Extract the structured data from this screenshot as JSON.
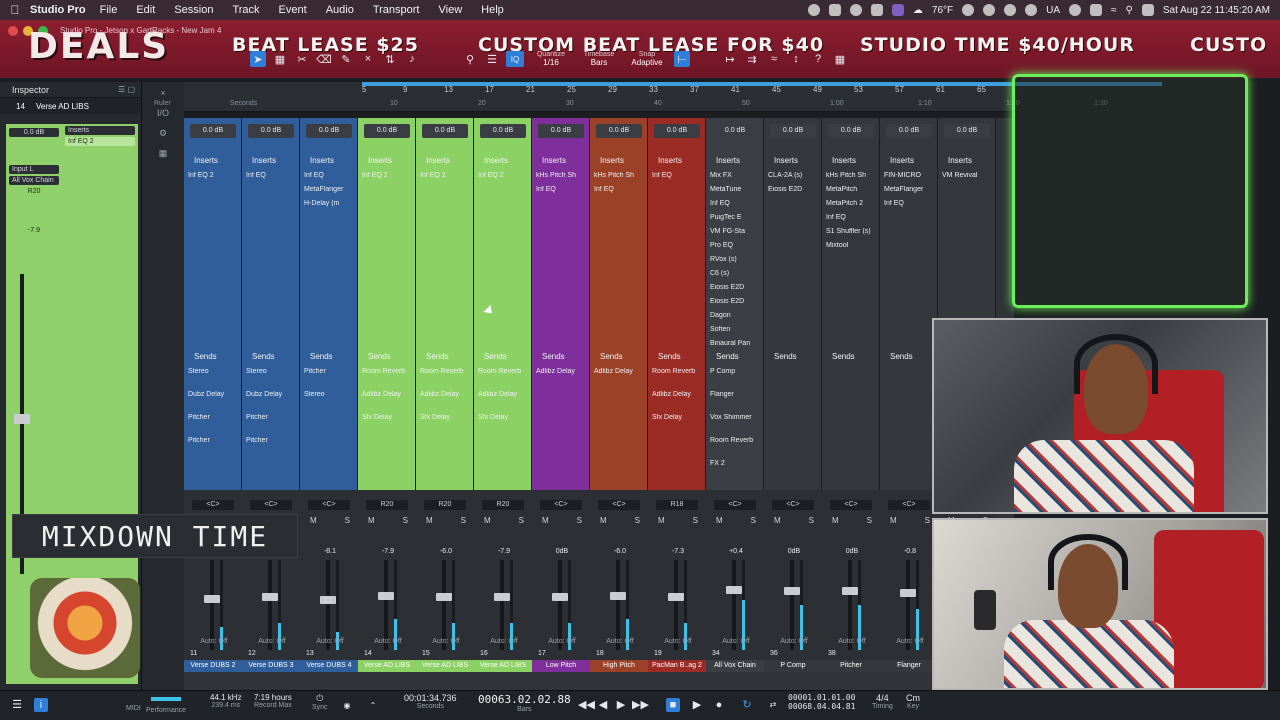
{
  "menubar": {
    "app_name": "Studio Pro",
    "items": [
      "File",
      "Edit",
      "Session",
      "Track",
      "Event",
      "Audio",
      "Transport",
      "View",
      "Help"
    ],
    "weather": "76°F",
    "lang": "UA",
    "datetime": "Sat Aug 22  11:45:20 AM"
  },
  "banner": {
    "window_title": "Studio Pro - Jetson x GartRacks - New Jam 4",
    "brand": "DEALS",
    "ticker": [
      "BEAT LEASE $25",
      "CUSTOM BEAT LEASE FOR $40",
      "STUDIO TIME $40/HOUR",
      "CUSTO"
    ],
    "toolbar": {
      "quantize_label": "Quantize",
      "quantize_value": "1/16",
      "timebase_label": "Timebase",
      "timebase_value": "Bars",
      "snap_label": "Snap",
      "snap_value": "Adaptive",
      "iq_label": "IQ"
    }
  },
  "inspector": {
    "title": "Inspector",
    "track_number": "14",
    "track_name": "Verse AD LIBS",
    "inserts_label": "Inserts",
    "insert": "Inf EQ 2",
    "input_label": "Input L",
    "input_value": "All Vox Chain",
    "db_value": "0.0 dB",
    "pan_value": "R20",
    "vol_value": "-7.9"
  },
  "overlay": {
    "mixdown_text": "MIXDOWN TIME"
  },
  "ruler": {
    "bars": [
      "5",
      "9",
      "13",
      "17",
      "21",
      "25",
      "29",
      "33",
      "37",
      "41",
      "45",
      "49",
      "53",
      "57",
      "61",
      "65"
    ],
    "seconds": [
      "10",
      "20",
      "30",
      "40",
      "50",
      "1:00",
      "1:10",
      "1:20",
      "1:30"
    ],
    "ruler_label": "Ruler",
    "seconds_label": "Seconds"
  },
  "mixer": {
    "inserts_label": "Inserts",
    "sends_label": "Sends",
    "channels": [
      {
        "num": "11",
        "name": "Verse DUBS 2",
        "color": "#2f5e9a",
        "db": "0.0 dB",
        "inserts": [
          "Inf EQ 2"
        ],
        "sends": [
          "Stereo",
          "Dubz Delay",
          "Pitcher",
          "Pitcher"
        ],
        "pan": "<C>",
        "vol": "",
        "auto": "Auto: Off"
      },
      {
        "num": "12",
        "name": "Verse DUBS 3",
        "color": "#2f5e9a",
        "db": "0.0 dB",
        "inserts": [
          "Inf EQ"
        ],
        "sends": [
          "Stereo",
          "Dubz Delay",
          "Pitcher",
          "Pitcher"
        ],
        "pan": "<C>",
        "vol": "",
        "auto": "Auto: Off"
      },
      {
        "num": "13",
        "name": "Verse DUBS 4",
        "color": "#2f5e9a",
        "db": "0.0 dB",
        "inserts": [
          "Inf EQ",
          "MetaFlanger",
          "H-Delay (m"
        ],
        "sends": [
          "Pitcher",
          "Stereo"
        ],
        "pan": "<C>",
        "vol": "-8.1",
        "auto": "Auto: Off"
      },
      {
        "num": "14",
        "name": "Verse AD LIBS",
        "color": "#8bd163",
        "db": "0.0 dB",
        "inserts": [
          "Inf EQ 2"
        ],
        "sends": [
          "Room Reverb",
          "Adlibz Delay",
          "Sfx Delay"
        ],
        "pan": "R20",
        "vol": "-7.9",
        "auto": "Auto: Off"
      },
      {
        "num": "15",
        "name": "Verse AD LIBS",
        "color": "#8bd163",
        "db": "0.0 dB",
        "inserts": [
          "Inf EQ 2"
        ],
        "sends": [
          "Room Reverb",
          "Adlibz Delay",
          "Sfx Delay"
        ],
        "pan": "R20",
        "vol": "-6.0",
        "auto": "Auto: Off"
      },
      {
        "num": "16",
        "name": "Verse AD LIBS",
        "color": "#8bd163",
        "db": "0.0 dB",
        "inserts": [
          "Inf EQ 2"
        ],
        "sends": [
          "Room Reverb",
          "Adlibz Delay",
          "Sfx Delay"
        ],
        "pan": "R20",
        "vol": "-7.9",
        "auto": "Auto: Off"
      },
      {
        "num": "17",
        "name": "Low Pitch",
        "color": "#7e2f9c",
        "db": "0.0 dB",
        "inserts": [
          "kHs Pitch Sh",
          "Inf EQ"
        ],
        "sends": [
          "Adlibz Delay"
        ],
        "pan": "<C>",
        "vol": "0dB",
        "auto": "Auto: Off"
      },
      {
        "num": "18",
        "name": "High Pitch",
        "color": "#9a4127",
        "db": "0.0 dB",
        "inserts": [
          "kHs Pitch Sh",
          "Inf EQ"
        ],
        "sends": [
          "Adlibz Delay"
        ],
        "pan": "<C>",
        "vol": "-6.0",
        "auto": "Auto: Off"
      },
      {
        "num": "19",
        "name": "PacMan B..ag 2",
        "color": "#9b2b25",
        "db": "0.0 dB",
        "inserts": [
          "Inf EQ"
        ],
        "sends": [
          "Room Reverb",
          "Adlibz Delay",
          "Sfx Delay"
        ],
        "pan": "R18",
        "vol": "-7.3",
        "auto": "Auto: Off"
      },
      {
        "num": "34",
        "name": "All Vox Chain",
        "color": "#3b3e44",
        "db": "0.0 dB",
        "inserts": [
          "Mix FX",
          "MetaTune",
          "Inf EQ",
          "PuigTec E",
          "VM FG-Sta",
          "Pro EQ",
          "RVox (s)",
          "C6 (s)",
          "Eiosis E2D",
          "Eiosis E2D",
          "Dagon",
          "Soften",
          "Binaural Pan"
        ],
        "sends": [
          "P Comp",
          "Flanger",
          "Vox Shimmer",
          "Room Reverb",
          "FX 2"
        ],
        "pan": "<C>",
        "vol": "+0.4",
        "auto": "Auto: Off"
      },
      {
        "num": "36",
        "name": "P Comp",
        "color": "#34373c",
        "db": "0.0 dB",
        "inserts": [
          "CLA-2A (s)",
          "Eiosis E2D"
        ],
        "sends": [],
        "pan": "<C>",
        "vol": "0dB",
        "auto": "Auto: Off"
      },
      {
        "num": "38",
        "name": "Pitcher",
        "color": "#34373c",
        "db": "0.0 dB",
        "inserts": [
          "kHs Pitch Sh",
          "MetaPitch",
          "MetaPitch 2",
          "Inf EQ",
          "S1 Shuffler (s)",
          "Mixtool"
        ],
        "sends": [],
        "pan": "<C>",
        "vol": "0dB",
        "auto": "Auto: Off"
      },
      {
        "num": "",
        "name": "Flanger",
        "color": "#34373c",
        "db": "0.0 dB",
        "inserts": [
          "FIN-MICRO",
          "MetaFlanger",
          "Inf EQ"
        ],
        "sends": [],
        "pan": "<C>",
        "vol": "-0.8",
        "auto": "Auto: Off"
      },
      {
        "num": "",
        "name": "",
        "color": "#34373c",
        "db": "0.0 dB",
        "inserts": [
          "VM Revival"
        ],
        "sends": [],
        "pan": "",
        "vol": "",
        "auto": ""
      }
    ],
    "meters": [
      0.25,
      0.3,
      0.2,
      0.35,
      0.3,
      0.3,
      0.3,
      0.35,
      0.3,
      0.55,
      0.5,
      0.5,
      0.45,
      0.1
    ]
  },
  "transport": {
    "sample_rate": "44.1 kHz",
    "sample_sub": "239.4 ms",
    "record_time": "7:19 hours",
    "record_label": "Record Max",
    "midi_label": "MIDI",
    "performance_label": "Performance",
    "sync_label": "Sync",
    "seconds_value": "00:01:34.736",
    "seconds_label": "Seconds",
    "bars_value": "00063.02.02.88",
    "bars_label": "Bars",
    "loop_start": "00001.01.01.00",
    "loop_end": "00068.04.04.81",
    "timesig": "4/4",
    "timing_label": "Timing",
    "key_value": "Cm",
    "key_label": "Key"
  },
  "colors": {
    "accent": "#2f7fd8",
    "banner_red": "#8c1e2f",
    "cam_green": "#6cf05a",
    "track_blue": "#2f5e9a",
    "track_green": "#8bd163"
  }
}
